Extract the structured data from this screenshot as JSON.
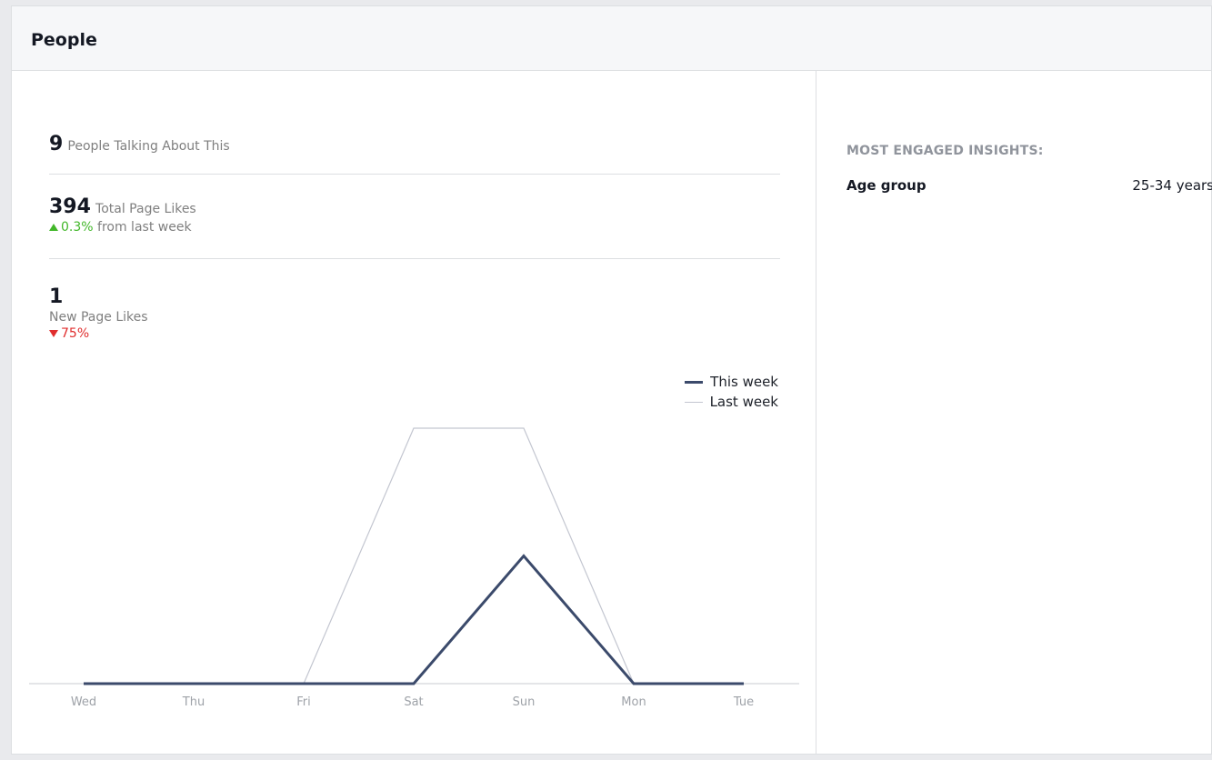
{
  "panel": {
    "title": "People"
  },
  "metrics": {
    "talking": {
      "value": "9",
      "label": "People Talking About This"
    },
    "total_likes": {
      "value": "394",
      "label": "Total Page Likes",
      "change": "0.3%",
      "change_suffix": "from last week",
      "direction": "up"
    },
    "new_likes": {
      "value": "1",
      "label": "New Page Likes",
      "change": "75%",
      "direction": "down"
    }
  },
  "legend": {
    "this_week": "This week",
    "last_week": "Last week"
  },
  "insights": {
    "title": "MOST ENGAGED INSIGHTS:",
    "rows": [
      {
        "label": "Age group",
        "value": "25-34 years"
      }
    ]
  },
  "colors": {
    "this_week": "#3b4a6b",
    "last_week": "#c3c6d0",
    "up": "#42b72a",
    "down": "#e02d2d"
  },
  "chart_data": {
    "type": "line",
    "categories": [
      "Wed",
      "Thu",
      "Fri",
      "Sat",
      "Sun",
      "Mon",
      "Tue"
    ],
    "series": [
      {
        "name": "This week",
        "values": [
          0,
          0,
          0,
          0,
          1,
          0,
          0
        ]
      },
      {
        "name": "Last week",
        "values": [
          0,
          0,
          0,
          2,
          2,
          0,
          0
        ]
      }
    ],
    "ylim": [
      0,
      2
    ],
    "grid": false,
    "legend_position": "top-right"
  }
}
